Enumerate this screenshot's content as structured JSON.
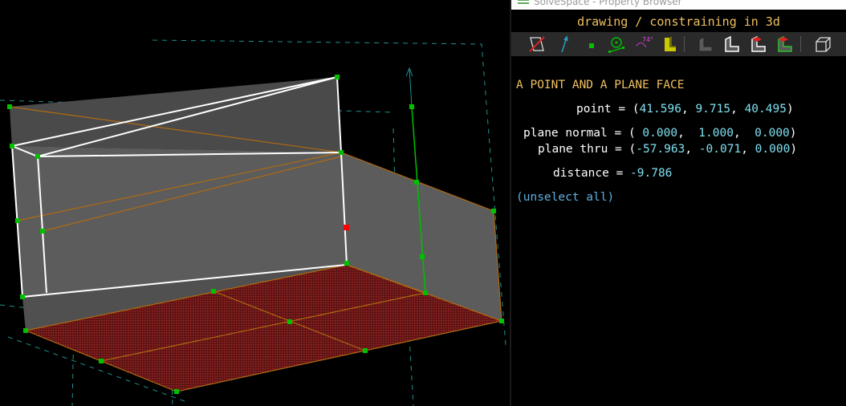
{
  "window": {
    "title": "SolveSpace - Property Browser"
  },
  "browser": {
    "banner": "drawing / constraining in 3d",
    "toolbar": [
      {
        "icon": "hide-all-icon"
      },
      {
        "icon": "show-normals-icon"
      },
      {
        "icon": "show-points-icon"
      },
      {
        "icon": "show-construction-icon"
      },
      {
        "icon": "show-constraints-icon"
      },
      {
        "icon": "show-workplanes-icon"
      },
      {
        "icon": "shaded-solid-icon"
      },
      {
        "icon": "solid-edges-icon"
      },
      {
        "icon": "outlines-icon"
      },
      {
        "icon": "mesh-icon"
      },
      {
        "icon": "perspective-icon"
      }
    ],
    "heading": "A POINT AND A PLANE FACE",
    "point": {
      "label": "point = ",
      "open": "(",
      "x": "41.596",
      "y": "9.715",
      "z": "40.495",
      "close": ")"
    },
    "plane_normal": {
      "label": "plane normal = ",
      "open": "( ",
      "x": "0.000",
      "y": "1.000",
      "z": "0.000",
      "close": ")"
    },
    "plane_thru": {
      "label": "plane thru = ",
      "open": "(",
      "x": "-57.963",
      "y": "-0.071",
      "z": "0.000",
      "close": ")"
    },
    "distance": {
      "label": "distance = ",
      "value": "-9.786"
    },
    "unselect_link": "(unselect all)"
  },
  "colors": {
    "background": "#000000",
    "face_fill": "#5a5a5a",
    "selected_face": "#6e1a1a",
    "edge": "#ffffff",
    "edge_construction": "#b06a10",
    "point": "#00c000",
    "point_selected": "#ff0000",
    "workplane": "#1f8f8f",
    "constraint": "#00c000"
  }
}
